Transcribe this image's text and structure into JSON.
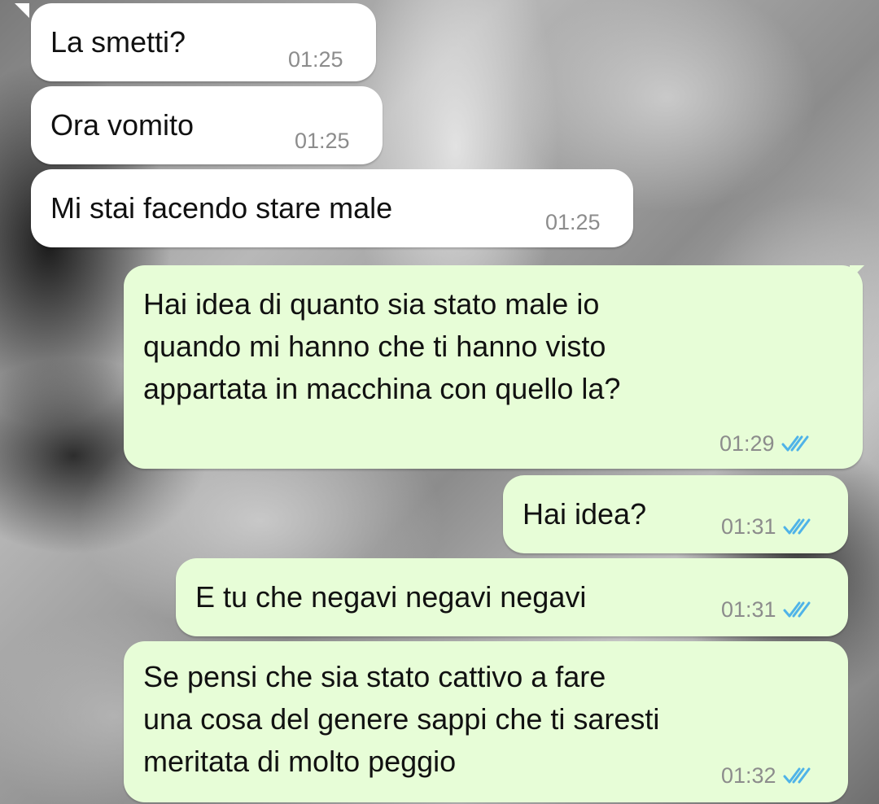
{
  "messages": [
    {
      "direction": "incoming",
      "text": "La smetti?",
      "time": "01:25"
    },
    {
      "direction": "incoming",
      "text": "Ora vomito",
      "time": "01:25"
    },
    {
      "direction": "incoming",
      "text": "Mi stai facendo stare male",
      "time": "01:25"
    },
    {
      "direction": "outgoing",
      "text": "Hai idea di quanto sia stato male io\nquando mi hanno che ti hanno visto\nappartata in macchina con quello la?",
      "time": "01:29",
      "status": "read"
    },
    {
      "direction": "outgoing",
      "text": "Hai idea?",
      "time": "01:31",
      "status": "read"
    },
    {
      "direction": "outgoing",
      "text": "E tu che negavi negavi negavi",
      "time": "01:31",
      "status": "read"
    },
    {
      "direction": "outgoing",
      "text": "Se pensi che sia stato cattivo a fare\nuna cosa del genere sappi che ti saresti\nmeritata di molto peggio",
      "time": "01:32",
      "status": "read"
    }
  ],
  "colors": {
    "incoming_bubble": "#ffffff",
    "outgoing_bubble": "#e7fdd7",
    "timestamp": "#8c8c8c",
    "read_check": "#4fb3e8"
  },
  "icons": {
    "read_receipt": "double-check-icon"
  }
}
